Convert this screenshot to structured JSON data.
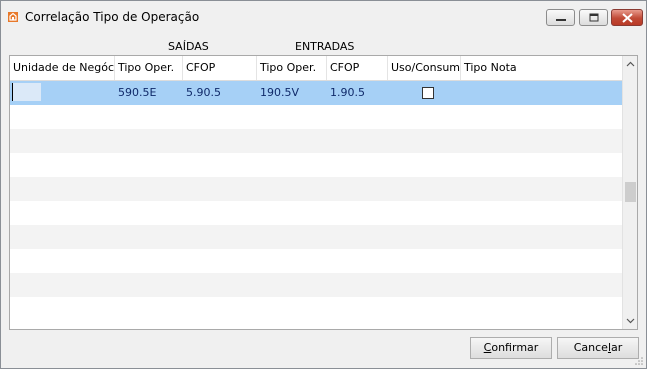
{
  "window": {
    "title": "Correlação Tipo de Operação",
    "icon": "app-logo-icon"
  },
  "group_headers": {
    "saidas": "SAÍDAS",
    "entradas": "ENTRADAS"
  },
  "columns": [
    "Unidade de Negócio",
    "Tipo Oper.",
    "CFOP",
    "Tipo Oper.",
    "CFOP",
    "Uso/Consumo",
    "Tipo Nota"
  ],
  "rows": [
    {
      "unidade": "",
      "saida_tipo_oper": "590.5E",
      "saida_cfop": "5.90.5",
      "entrada_tipo_oper": "190.5V",
      "entrada_cfop": "1.90.5",
      "uso_consumo": false,
      "tipo_nota": "",
      "selected": true
    }
  ],
  "buttons": {
    "confirm": "Confirmar",
    "cancel": "Cancelar"
  },
  "colors": {
    "selected_row": "#a6d0f6",
    "alt_row": "#f3f3f3",
    "cell_text": "#102a6a"
  }
}
